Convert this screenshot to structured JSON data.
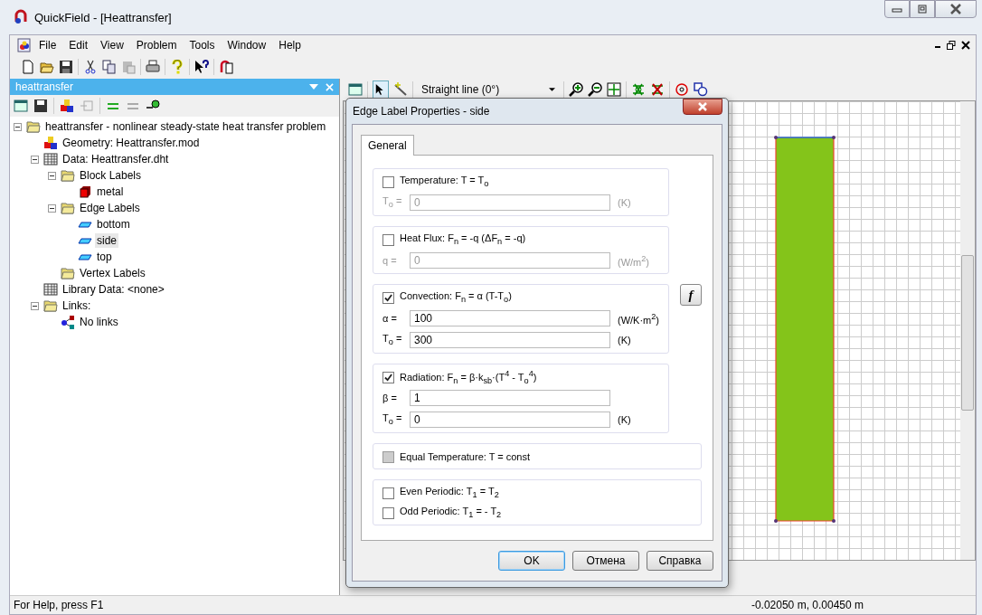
{
  "window": {
    "title": "QuickField - [Heattransfer]"
  },
  "menu": [
    "File",
    "Edit",
    "View",
    "Problem",
    "Tools",
    "Window",
    "Help"
  ],
  "pane": {
    "title": "heattransfer"
  },
  "tree": [
    {
      "label": "heattransfer - nonlinear steady-state heat transfer problem",
      "kind": "folder",
      "expanded": true,
      "selected": false,
      "children": [
        {
          "label": "Geometry: Heattransfer.mod",
          "kind": "geometry",
          "selected": false
        },
        {
          "label": "Data: Heattransfer.dht",
          "kind": "table",
          "expanded": true,
          "selected": false,
          "children": [
            {
              "label": "Block Labels",
              "kind": "folder",
              "expanded": true,
              "selected": false,
              "children": [
                {
                  "label": "metal",
                  "kind": "block",
                  "selected": false
                }
              ]
            },
            {
              "label": "Edge Labels",
              "kind": "folder",
              "expanded": true,
              "selected": false,
              "children": [
                {
                  "label": "bottom",
                  "kind": "edge",
                  "selected": false
                },
                {
                  "label": "side",
                  "kind": "edge",
                  "selected": true
                },
                {
                  "label": "top",
                  "kind": "edge",
                  "selected": false
                }
              ]
            },
            {
              "label": "Vertex Labels",
              "kind": "folder",
              "selected": false
            }
          ]
        },
        {
          "label": "Library Data: <none>",
          "kind": "table",
          "selected": false
        },
        {
          "label": "Links:",
          "kind": "folder",
          "expanded": true,
          "selected": false,
          "children": [
            {
              "label": "No links",
              "kind": "link",
              "selected": false
            }
          ]
        }
      ]
    }
  ],
  "view_toolbar": {
    "shape": "Straight line (0°)"
  },
  "dialog": {
    "title": "Edge Label Properties - side",
    "tabs": [
      {
        "label": "General",
        "selected": true
      }
    ],
    "groups": [
      {
        "options": [
          {
            "label": "Temperature: T = T$_{o}$",
            "checked": false,
            "disabled": false
          }
        ],
        "fields": [
          {
            "label": "T$_{o}$ =",
            "value": "0",
            "unit": "(K)"
          }
        ]
      },
      {
        "options": [
          {
            "label": "Heat Flux: F$_{n}$ = -q (ΔF$_{n}$ = -q)",
            "checked": false,
            "disabled": false
          }
        ],
        "fields": [
          {
            "label": "q =",
            "value": "0",
            "unit": "(W/m$^{2}$)"
          }
        ]
      },
      {
        "options": [
          {
            "label": "Convection: F$_{n}$ = α (T-T$_{o}$)",
            "checked": true,
            "disabled": false
          }
        ],
        "fields": [
          {
            "label": "α =",
            "value": "100",
            "unit": "(W/K·m$^{2}$)"
          },
          {
            "label": "T$_{o}$ =",
            "value": "300",
            "unit": "(K)"
          }
        ],
        "side_button": "f"
      },
      {
        "options": [
          {
            "label": "Radiation: F$_{n}$ = β·k$_{sb}$·(T$^{4}$ - T$_{o}$$^{4}$)",
            "checked": true,
            "disabled": false
          }
        ],
        "fields": [
          {
            "label": "β =",
            "value": "1"
          },
          {
            "label": "T$_{o}$ =",
            "value": "0",
            "unit": "(K)"
          }
        ]
      },
      {
        "options": [
          {
            "label": "Equal Temperature: T = const",
            "checked": false,
            "disabled": true
          }
        ]
      },
      {
        "options": [
          {
            "label": "Even Periodic: T$_{1}$ = T$_{2}$",
            "checked": false,
            "disabled": false
          },
          {
            "label": "Odd Periodic: T$_{1}$ = - T$_{2}$",
            "checked": false,
            "disabled": false
          }
        ]
      }
    ],
    "buttons": [
      {
        "label": "OK",
        "default": true
      },
      {
        "label": "Отмена",
        "default": false
      },
      {
        "label": "Справка",
        "default": false
      }
    ]
  },
  "status_bar": {
    "help": "For Help, press F1",
    "coordinates": "-0.02050 m, 0.00450 m"
  }
}
